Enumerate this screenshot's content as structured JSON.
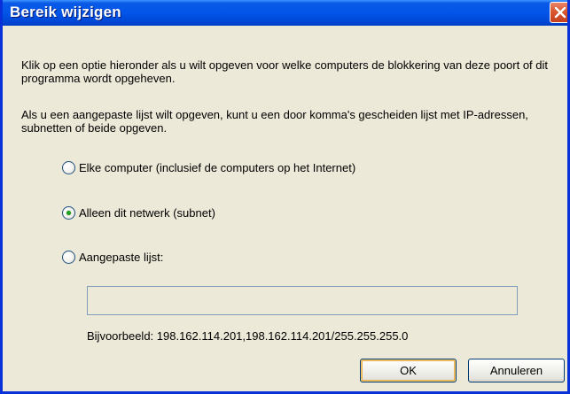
{
  "window": {
    "title": "Bereik wijzigen",
    "accent_color": "#0831d9"
  },
  "intro_text": "Klik op een optie hieronder als u wilt opgeven voor welke computers de blokkering van deze poort of dit programma wordt opgeheven.",
  "custom_text": "Als u een aangepaste lijst wilt opgeven, kunt u een door komma's gescheiden lijst met IP-adressen, subnetten of beide opgeven.",
  "options": [
    {
      "label": "Elke computer (inclusief de computers op het Internet)",
      "selected": false
    },
    {
      "label": "Alleen dit netwerk (subnet)",
      "selected": true
    },
    {
      "label": "Aangepaste lijst:",
      "selected": false
    }
  ],
  "custom_list": {
    "value": "",
    "example": "Bijvoorbeeld: 198.162.114.201,198.162.114.201/255.255.255.0"
  },
  "buttons": {
    "ok_label": "OK",
    "cancel_label": "Annuleren"
  },
  "icons": {
    "close": "close-icon"
  }
}
